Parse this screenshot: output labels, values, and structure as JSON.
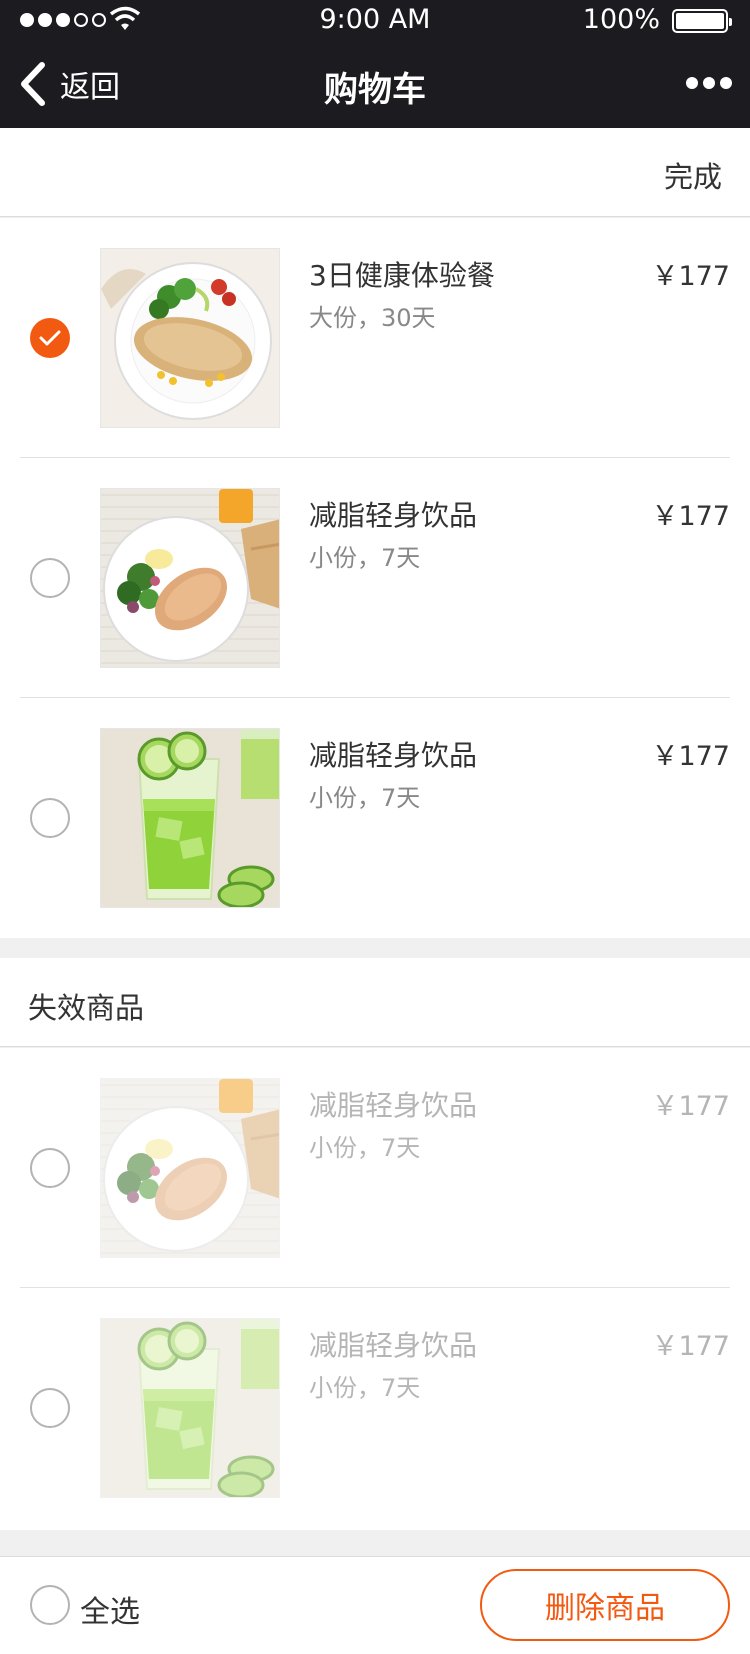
{
  "status": {
    "time": "9:00 AM",
    "battery": "100%"
  },
  "nav": {
    "back_label": "返回",
    "title": "购物车"
  },
  "editbar": {
    "done_label": "完成"
  },
  "cart": {
    "items": [
      {
        "name": "3日健康体验餐",
        "spec": "大份，30天",
        "price": "￥177",
        "checked": true,
        "image": "chicken-plate-image"
      },
      {
        "name": "减脂轻身饮品",
        "spec": "小份，7天",
        "price": "￥177",
        "checked": false,
        "image": "chicken-salad-image"
      },
      {
        "name": "减脂轻身饮品",
        "spec": "小份，7天",
        "price": "￥177",
        "checked": false,
        "image": "cucumber-juice-image"
      }
    ]
  },
  "invalid": {
    "title": "失效商品",
    "items": [
      {
        "name": "减脂轻身饮品",
        "spec": "小份，7天",
        "price": "￥177",
        "image": "chicken-salad-image"
      },
      {
        "name": "减脂轻身饮品",
        "spec": "小份，7天",
        "price": "￥177",
        "image": "cucumber-juice-image"
      }
    ]
  },
  "footer": {
    "select_all_label": "全选",
    "delete_label": "删除商品"
  },
  "colors": {
    "accent": "#f25a12",
    "topbar": "#1c1b20"
  }
}
